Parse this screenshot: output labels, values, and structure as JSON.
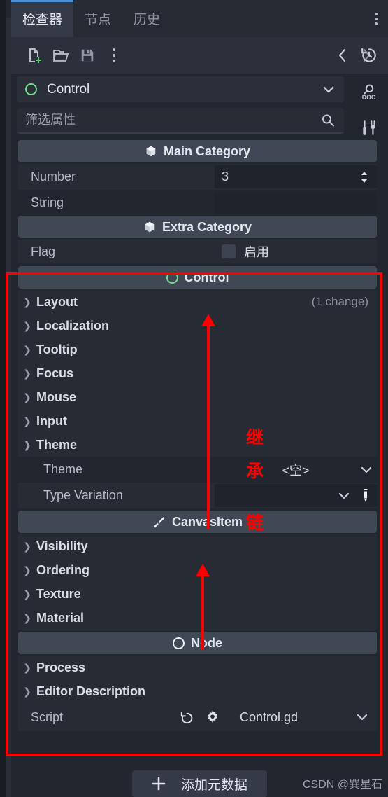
{
  "tabs": [
    {
      "label": "检查器",
      "active": true
    },
    {
      "label": "节点",
      "active": false
    },
    {
      "label": "历史",
      "active": false
    }
  ],
  "toolbar": {
    "new_icon": "new-file-icon",
    "open_icon": "open-folder-icon",
    "save_icon": "save-icon",
    "more_icon": "kebab-menu-icon",
    "back_icon": "chevron-left-icon",
    "forward_icon": "chevron-right-icon",
    "history_icon": "history-icon"
  },
  "rail": {
    "history_label": "history-icon",
    "doc_label": "search-doc-icon",
    "tools_label": "tools-icon"
  },
  "selector": {
    "node_name": "Control",
    "icon": "green-ring-icon",
    "chevron": "chevron-down-icon"
  },
  "search": {
    "placeholder": "筛选属性",
    "value": "",
    "icon": "search-icon"
  },
  "sections": [
    {
      "type": "category",
      "title": "Main Category",
      "icon": "cube-icon"
    },
    {
      "type": "property",
      "name": "Number",
      "value": "3",
      "control": "spinner"
    },
    {
      "type": "property",
      "name": "String",
      "value": "",
      "control": "textfield"
    },
    {
      "type": "category",
      "title": "Extra Category",
      "icon": "cube-icon"
    },
    {
      "type": "property",
      "name": "Flag",
      "value": "启用",
      "control": "checkbox"
    },
    {
      "type": "category",
      "title": "Control",
      "icon": "green-ring-icon"
    },
    {
      "type": "group",
      "name": "Layout",
      "expanded": false,
      "note": "(1 change)"
    },
    {
      "type": "group",
      "name": "Localization",
      "expanded": false,
      "note": ""
    },
    {
      "type": "group",
      "name": "Tooltip",
      "expanded": false,
      "note": ""
    },
    {
      "type": "group",
      "name": "Focus",
      "expanded": false,
      "note": ""
    },
    {
      "type": "group",
      "name": "Mouse",
      "expanded": false,
      "note": ""
    },
    {
      "type": "group",
      "name": "Input",
      "expanded": false,
      "note": ""
    },
    {
      "type": "group",
      "name": "Theme",
      "expanded": true,
      "note": ""
    },
    {
      "type": "property",
      "name": "Theme",
      "value": "<空>",
      "control": "dropdown",
      "indent": true
    },
    {
      "type": "property",
      "name": "Type Variation",
      "value": "",
      "control": "dropdown-edit",
      "indent": true
    },
    {
      "type": "category",
      "title": "CanvasItem",
      "icon": "brush-icon"
    },
    {
      "type": "group",
      "name": "Visibility",
      "expanded": false,
      "note": ""
    },
    {
      "type": "group",
      "name": "Ordering",
      "expanded": false,
      "note": ""
    },
    {
      "type": "group",
      "name": "Texture",
      "expanded": false,
      "note": ""
    },
    {
      "type": "group",
      "name": "Material",
      "expanded": false,
      "note": ""
    },
    {
      "type": "category",
      "title": "Node",
      "icon": "white-ring-icon"
    },
    {
      "type": "group",
      "name": "Process",
      "expanded": false,
      "note": ""
    },
    {
      "type": "group",
      "name": "Editor Description",
      "expanded": false,
      "note": ""
    }
  ],
  "script_row": {
    "label": "Script",
    "value": "Control.gd",
    "revert_icon": "revert-icon",
    "settings_icon": "gear-icon",
    "chevron": "chevron-down-icon"
  },
  "add_metadata": {
    "label": "添加元数据",
    "icon": "plus-icon"
  },
  "annotations": {
    "chain_char_1": "继",
    "chain_char_2": "承",
    "chain_char_3": "链"
  },
  "watermark": "CSDN @巽星石",
  "colors": {
    "accent": "#4b8fd6",
    "green": "#6fdd8b",
    "annotation_red": "#ff0000",
    "panel_bg": "#22262e",
    "category_bg": "#414855"
  }
}
